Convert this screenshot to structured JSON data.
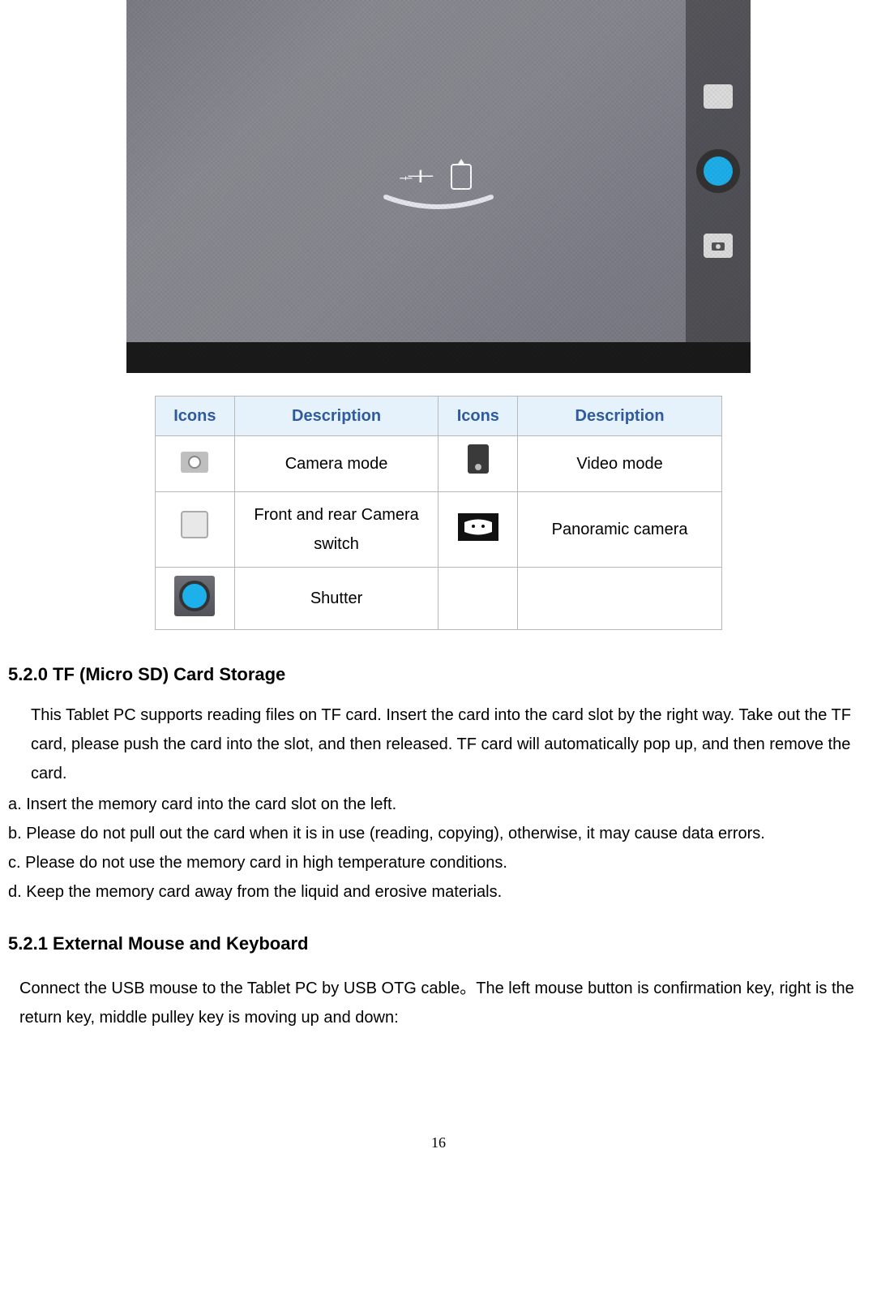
{
  "table": {
    "headers": {
      "icons1": "Icons",
      "desc1": "Description",
      "icons2": "Icons",
      "desc2": "Description"
    },
    "rows": [
      {
        "desc_left": "Camera mode",
        "desc_right": "Video   mode"
      },
      {
        "desc_left": "Front and rear Camera switch",
        "desc_right": "Panoramic camera"
      },
      {
        "desc_left": "Shutter",
        "desc_right": ""
      }
    ]
  },
  "sections": {
    "s520_title": "5.2.0 TF (Micro SD) Card Storage",
    "s520_intro": "This Tablet PC supports reading files on TF card. Insert the card into the card slot by the right way. Take out the TF card, please push the card into the slot, and then released. TF card will automatically pop up, and then remove the card.",
    "s520_a": "a.      Insert the memory card into the card slot on the left.",
    "s520_b": "b. Please do not pull out the card when it is in use (reading, copying), otherwise, it may cause data errors.",
    "s520_c": "c. Please do not use the memory card in high temperature conditions.",
    "s520_d": "d. Keep the memory card away from the liquid and erosive materials.",
    "s521_title": "5.2.1 External Mouse and Keyboard",
    "s521_body": "Connect the USB mouse to the Tablet PC by USB OTG cable。The left mouse button is confirmation key, right is the return key, middle pulley key is moving up and down:"
  },
  "page_number": "16"
}
